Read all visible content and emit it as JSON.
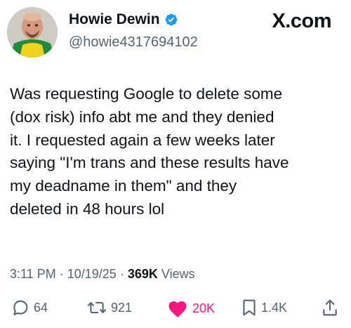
{
  "author": {
    "display_name": "Howie Dewin",
    "handle": "@howie4317694102",
    "verified": true,
    "avatar_icon": "profile-photo"
  },
  "brand": "X.com",
  "tweet": {
    "text": "Was requesting Google to delete some\n(dox risk) info abt me and they denied\nit. I requested again a few weeks later\nsaying \"I'm trans and these results have\nmy deadname in them\" and they\ndeleted in 48 hours lol"
  },
  "meta": {
    "time": "3:11 PM",
    "separator": "·",
    "date": "10/19/25",
    "views_count": "369K",
    "views_label": "Views"
  },
  "actions": {
    "replies": {
      "icon": "reply-icon",
      "count": "64"
    },
    "reposts": {
      "icon": "repost-icon",
      "count": "921"
    },
    "likes": {
      "icon": "heart-icon",
      "count": "20K",
      "liked": true
    },
    "bookmarks": {
      "icon": "bookmark-icon",
      "count": "1.4K"
    },
    "share": {
      "icon": "share-icon"
    }
  },
  "colors": {
    "text": "#0f1419",
    "secondary": "#536471",
    "verified_blue": "#1d9bf0",
    "like_pink": "#f91880"
  }
}
